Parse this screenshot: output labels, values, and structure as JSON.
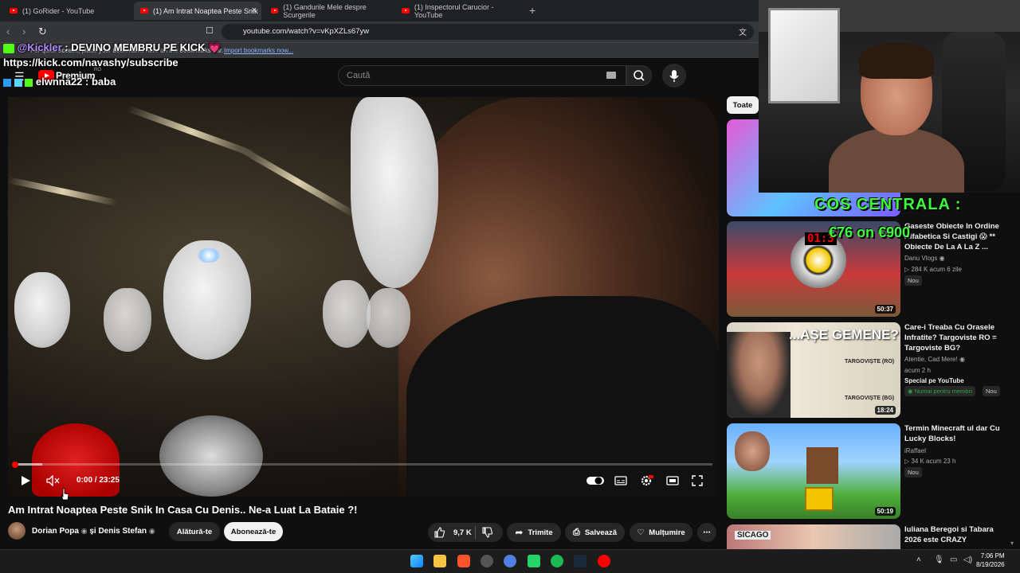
{
  "browser": {
    "tabs": [
      {
        "label": "(1) GoRider - YouTube",
        "active": false
      },
      {
        "label": "(1) Am Intrat Noaptea Peste Snik",
        "active": true
      },
      {
        "label": "(1) Gandurile Mele despre Scurgerile",
        "active": false
      },
      {
        "label": "(1) Inspectorul Carucior - YouTube",
        "active": false
      }
    ],
    "close_tab_glyph": "×",
    "new_tab_glyph": "+",
    "url": "youtube.com/watch?v=vKpXZLs67yw",
    "bookmark_bar_text": "For quick access, place your bookmarks here on the bookmarks bar.",
    "bookmark_bar_link": "Import bookmarks now..."
  },
  "youtube": {
    "premium_label": "Premium",
    "premium_region": "RO",
    "search_placeholder": "Caută",
    "video": {
      "time": "0:00 / 23:25",
      "progress_fraction": 0.04
    },
    "title": "Am Intrat Noaptea Peste Snik In Casa Cu Denis.. Ne-a Luat La Bataie ?!",
    "channel": "Dorian Popa",
    "channel_separator": "și Denis Stefan",
    "join_label": "Alătură-te",
    "subscribe_label": "Abonează-te",
    "likes": "9,7 K",
    "share_label": "Trimite",
    "save_label": "Salvează",
    "thanks_label": "Mulțumire",
    "more_glyph": "⋯"
  },
  "sidebar": {
    "chip": "Toate",
    "videos": [
      {
        "title_lines": [
          "Gaseste Obiecte In Ordine",
          "Alfabetica Si Castigi 😱 **",
          "Obiecte De La A La Z ..."
        ],
        "channel": "Danu Vlogs",
        "meta": "▷ 284 K  acum 6 zile",
        "badge": "Nou",
        "duration": "50:37"
      },
      {
        "title_lines": [
          "Care-i Treaba Cu Orasele",
          "Infratite? Targoviste RO =",
          "Targoviste BG?"
        ],
        "channel": "Atentie, Cad Mere!",
        "meta": "acum 2 h",
        "special": "Special pe YouTube",
        "members_badge": "Numai pentru membri",
        "badge": "Nou",
        "duration": "18:24",
        "thumb_text": "...AȘE GEMENE?",
        "map_labels": [
          "TARGOVIȘTE (RO)",
          "TARGOVIȘTE (BG)"
        ]
      },
      {
        "title_lines": [
          "Termin Minecraft ul dar Cu",
          "Lucky Blocks!"
        ],
        "channel": "iRaffael",
        "meta": "▷ 34 K  acum 23 h",
        "badge": "Nou",
        "duration": "50:19"
      },
      {
        "title_lines": [
          "Iuliana Beregoi si Tabara",
          "2026 este CRAZY"
        ],
        "thumb_text": "SICAGO"
      }
    ]
  },
  "stream_overlay": {
    "chat_line1_user": "@Kickler",
    "chat_line1_text": ": DEVINO MEMBRU PE KICK 💗",
    "chat_line2": "https://kick.com/navashy/subscribe",
    "chat_line3_user": "elwnna22",
    "chat_line3_text": ": baba",
    "cos_text": "COS CENTRALA :",
    "euro_text": "€76 on €900"
  },
  "taskbar": {
    "time": "7:06 PM",
    "date": "8/19/2026"
  },
  "colors": {
    "youtube_red": "#ff0000",
    "overlay_green": "#3cff3c",
    "chat_purple": "#b28cff"
  }
}
